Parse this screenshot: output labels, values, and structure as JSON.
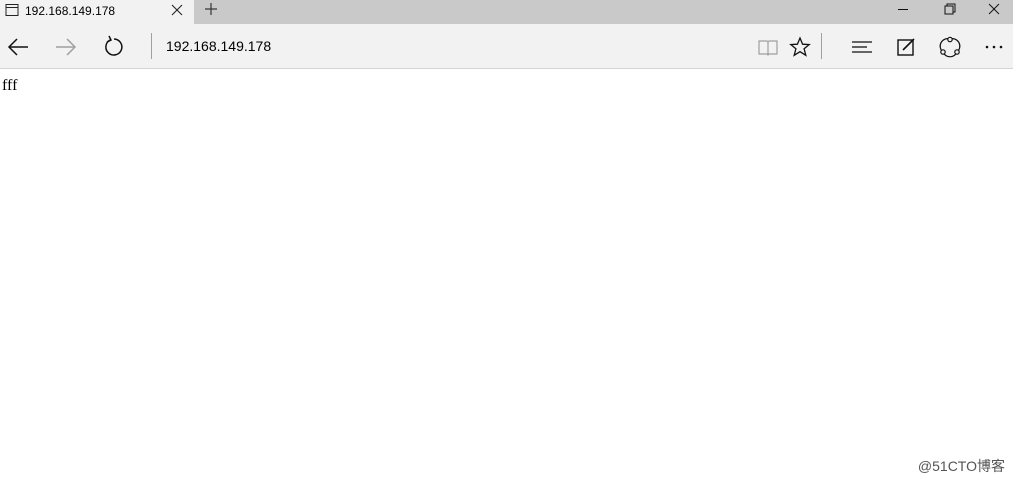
{
  "browser": {
    "tab": {
      "title": "192.168.149.178",
      "page_icon": "page-icon",
      "close_icon": "close-icon"
    },
    "new_tab_icon": "plus-icon",
    "window_controls": [
      "minimize-icon",
      "restore-icon",
      "close-icon"
    ],
    "navigation": {
      "back_icon": "arrow-left-icon",
      "forward_icon": "arrow-right-icon",
      "forward_enabled": false,
      "refresh_icon": "refresh-icon"
    },
    "address_bar": {
      "url": "192.168.149.178"
    },
    "toolbar_icons": [
      "reading-view-icon",
      "star-icon",
      "hub-icon",
      "web-note-icon",
      "share-icon",
      "more-icon"
    ]
  },
  "page": {
    "body_text": "fff"
  },
  "watermark": {
    "text": "@51CTO博客"
  },
  "colors": {
    "titlebar_bg": "#c9c9c9",
    "tab_active_bg": "#f2f2f2",
    "navbar_bg": "#f2f2f2",
    "page_bg": "#ffffff",
    "disabled_icon": "#a0a0a0"
  }
}
